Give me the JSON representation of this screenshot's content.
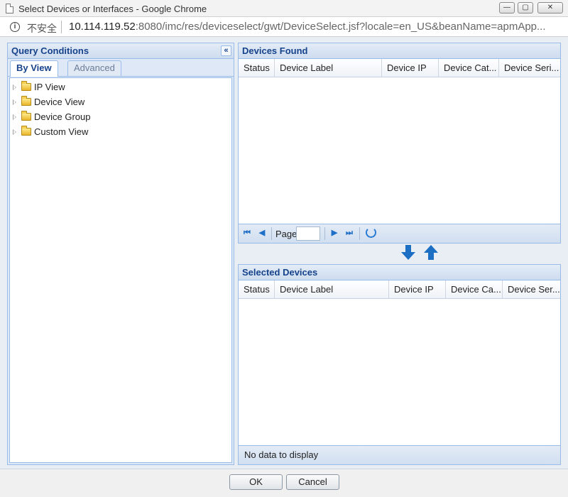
{
  "window": {
    "title": "Select Devices or Interfaces - Google Chrome",
    "minimize_glyph": "—",
    "maximize_glyph": "▢",
    "close_glyph": "✕"
  },
  "address": {
    "security_label": "不安全",
    "url_host": "10.114.119.52",
    "url_rest": ":8080/imc/res/deviceselect/gwt/DeviceSelect.jsf?locale=en_US&beanName=apmApp..."
  },
  "query": {
    "title": "Query Conditions",
    "collapse_glyph": "«",
    "tabs": [
      {
        "label": "By View",
        "active": true
      },
      {
        "label": "Advanced",
        "active": false
      }
    ],
    "tree": [
      {
        "label": "IP View"
      },
      {
        "label": "Device View"
      },
      {
        "label": "Device Group"
      },
      {
        "label": "Custom View"
      }
    ]
  },
  "found": {
    "title": "Devices Found",
    "columns": [
      "Status",
      "Device Label",
      "Device IP",
      "Device Cat...",
      "Device Seri..."
    ],
    "rows": [],
    "pager": {
      "page_label": "Page",
      "page_value": "",
      "first_glyph": "⏮",
      "prev_glyph": "◀",
      "next_glyph": "▶",
      "last_glyph": "⏭"
    }
  },
  "selected": {
    "title": "Selected Devices",
    "columns": [
      "Status",
      "Device Label",
      "Device IP",
      "Device Ca...",
      "Device Ser..."
    ],
    "rows": [],
    "status_text": "No data to display"
  },
  "footer": {
    "ok_label": "OK",
    "cancel_label": "Cancel"
  },
  "colors": {
    "panel_border": "#99bbe8",
    "header_text": "#15428b",
    "accent_blue": "#1d6fc4"
  }
}
